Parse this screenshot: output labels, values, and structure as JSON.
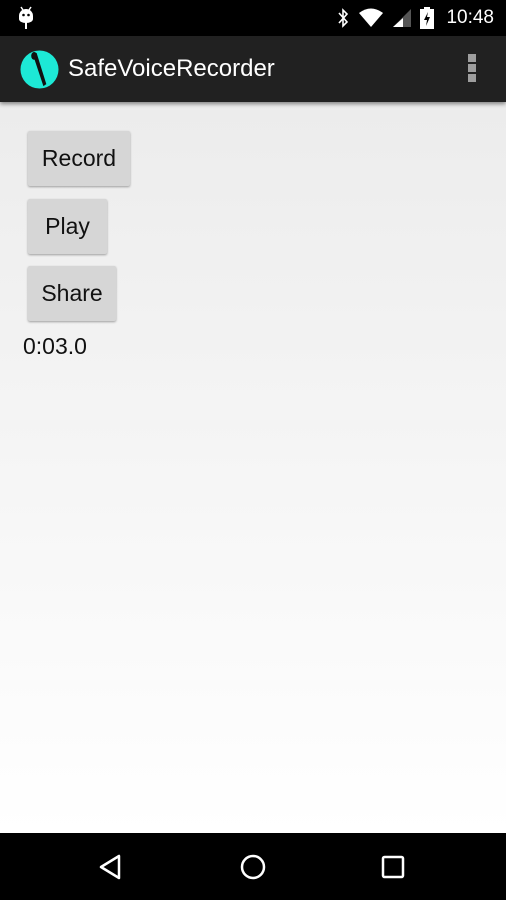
{
  "status_bar": {
    "notification_icon": "android-debug-icon",
    "icons": [
      "bluetooth-icon",
      "wifi-icon",
      "cell-signal-icon",
      "battery-charging-icon"
    ],
    "time": "10:48"
  },
  "app_bar": {
    "title": "SafeVoiceRecorder",
    "icon": "microphone-icon",
    "icon_color": "#1de9d6",
    "menu_icon": "overflow-menu-icon"
  },
  "main": {
    "buttons": [
      {
        "label": "Record"
      },
      {
        "label": "Play"
      },
      {
        "label": "Share"
      }
    ],
    "timer": "0:03.0"
  },
  "nav_bar": {
    "items": [
      "back-icon",
      "home-icon",
      "recent-apps-icon"
    ]
  }
}
